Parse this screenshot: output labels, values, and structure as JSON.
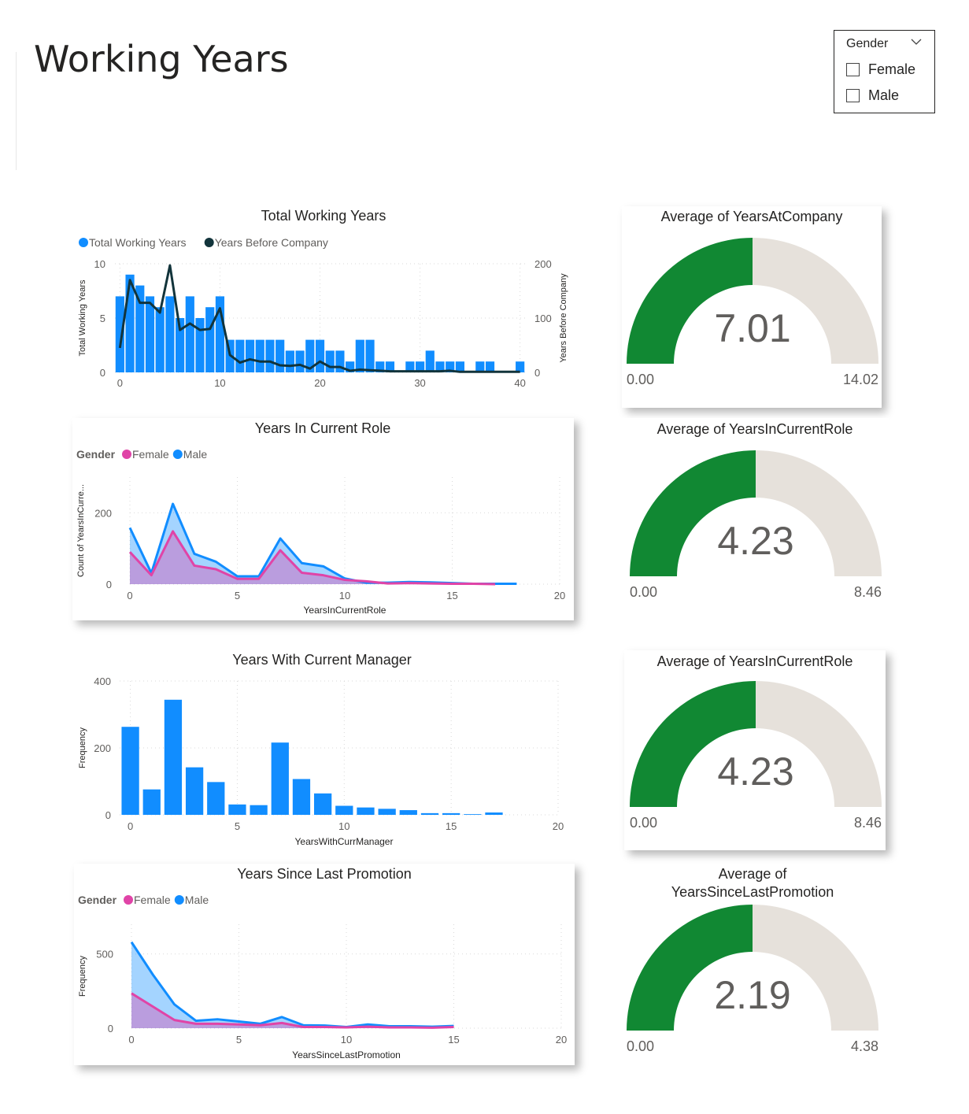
{
  "page": {
    "title": "Working Years"
  },
  "slicer": {
    "header": "Gender",
    "options": [
      "Female",
      "Male"
    ]
  },
  "charts": {
    "total_working_years": {
      "type": "bar",
      "title": "Total Working Years",
      "legend": [
        "Total Working Years",
        "Years Before Company"
      ],
      "ylabel": "Total Working Years",
      "y2label": "Years Before Company",
      "ylim": [
        0,
        10
      ],
      "y2lim": [
        0,
        200
      ],
      "xlim": [
        -0.5,
        40.5
      ],
      "yticks": [
        "0",
        "5",
        "10"
      ],
      "y2ticks": [
        "0",
        "100",
        "200"
      ],
      "xticks": [
        "0",
        "10",
        "20",
        "30",
        "40"
      ],
      "x": [
        0,
        1,
        2,
        3,
        4,
        5,
        6,
        7,
        8,
        9,
        10,
        11,
        12,
        13,
        14,
        15,
        16,
        17,
        18,
        19,
        20,
        21,
        22,
        23,
        24,
        25,
        26,
        27,
        28,
        29,
        30,
        31,
        32,
        33,
        34,
        35,
        36,
        37,
        38,
        39,
        40
      ],
      "bars": [
        7,
        9,
        8,
        7,
        6,
        7,
        5,
        7,
        5,
        6,
        7,
        3,
        3,
        3,
        3,
        3,
        3,
        2,
        2,
        3,
        3,
        2,
        2,
        1,
        3,
        3,
        1,
        1,
        0,
        1,
        1,
        2,
        1,
        1,
        1,
        0,
        1,
        1,
        0,
        0,
        1
      ],
      "line": [
        45,
        170,
        128,
        128,
        110,
        197,
        78,
        90,
        78,
        80,
        118,
        32,
        18,
        24,
        20,
        20,
        13,
        12,
        14,
        7,
        20,
        10,
        10,
        3,
        5,
        4,
        3,
        2,
        2,
        2,
        2,
        2,
        2,
        3,
        1,
        1,
        1,
        1,
        1,
        1,
        1
      ],
      "series_colors": [
        "#118DFF",
        "#12343B"
      ]
    },
    "years_in_current_role": {
      "type": "area",
      "title": "Years In Current Role",
      "legend_title": "Gender",
      "legend": [
        "Female",
        "Male"
      ],
      "xlabel": "YearsInCurrentRole",
      "ylabel": "Count of YearsInCurre...",
      "ylim": [
        0,
        300
      ],
      "xlim": [
        0,
        20
      ],
      "yticks": [
        "0",
        "200"
      ],
      "xticks": [
        "0",
        "5",
        "10",
        "15",
        "20"
      ],
      "x": [
        0,
        1,
        2,
        3,
        4,
        5,
        6,
        7,
        8,
        9,
        10,
        11,
        12,
        13,
        14,
        15,
        16,
        17,
        18
      ],
      "series": [
        {
          "name": "Female",
          "values": [
            90,
            25,
            148,
            52,
            42,
            15,
            15,
            95,
            32,
            25,
            12,
            8,
            2,
            3,
            2,
            1,
            1,
            0,
            null
          ]
        },
        {
          "name": "Male",
          "values": [
            158,
            31,
            225,
            85,
            63,
            22,
            22,
            128,
            59,
            50,
            16,
            4,
            4,
            6,
            5,
            3,
            1,
            1,
            1
          ]
        }
      ],
      "series_colors": [
        "#E044A7",
        "#118DFF"
      ]
    },
    "years_with_current_manager": {
      "type": "bar",
      "title": "Years With Current Manager",
      "xlabel": "YearsWithCurrManager",
      "ylabel": "Frequency",
      "ylim": [
        0,
        400
      ],
      "xlim": [
        -0.5,
        20
      ],
      "yticks": [
        "0",
        "200",
        "400"
      ],
      "xticks": [
        "0",
        "5",
        "10",
        "15",
        "20"
      ],
      "x": [
        0,
        1,
        2,
        3,
        4,
        5,
        6,
        7,
        8,
        9,
        10,
        11,
        12,
        13,
        14,
        15,
        16,
        17
      ],
      "values": [
        263,
        76,
        344,
        142,
        98,
        31,
        29,
        216,
        107,
        64,
        27,
        22,
        18,
        14,
        5,
        5,
        2,
        7
      ],
      "series_colors": [
        "#118DFF"
      ]
    },
    "years_since_last_promotion": {
      "type": "area",
      "title": "Years Since Last Promotion",
      "legend_title": "Gender",
      "legend": [
        "Female",
        "Male"
      ],
      "xlabel": "YearsSinceLastPromotion",
      "ylabel": "Frequency",
      "ylim": [
        0,
        700
      ],
      "xlim": [
        0,
        20
      ],
      "yticks": [
        "0",
        "500"
      ],
      "xticks": [
        "0",
        "5",
        "10",
        "15",
        "20"
      ],
      "x": [
        0,
        1,
        2,
        3,
        4,
        5,
        6,
        7,
        8,
        9,
        10,
        11,
        12,
        13,
        14,
        15
      ],
      "series": [
        {
          "name": "Female",
          "values": [
            235,
            145,
            55,
            30,
            30,
            25,
            20,
            35,
            8,
            8,
            5,
            10,
            5,
            5,
            3,
            8
          ]
        },
        {
          "name": "Male",
          "values": [
            580,
            360,
            160,
            50,
            60,
            45,
            30,
            75,
            20,
            18,
            8,
            25,
            13,
            13,
            10,
            15
          ]
        }
      ],
      "series_colors": [
        "#E044A7",
        "#118DFF"
      ]
    }
  },
  "gauges": [
    {
      "title": "Average of YearsAtCompany",
      "value": 7.01,
      "value_label": "7.01",
      "min_label": "0.00",
      "max_label": "14.02",
      "max": 14.02
    },
    {
      "title": "Average of YearsInCurrentRole",
      "value": 4.23,
      "value_label": "4.23",
      "min_label": "0.00",
      "max_label": "8.46",
      "max": 8.46
    },
    {
      "title": "Average of YearsInCurrentRole",
      "value": 4.23,
      "value_label": "4.23",
      "min_label": "0.00",
      "max_label": "8.46",
      "max": 8.46
    },
    {
      "title_lines": [
        "Average of",
        "YearsSinceLastPromotion"
      ],
      "value": 2.19,
      "value_label": "2.19",
      "min_label": "0.00",
      "max_label": "4.38",
      "max": 4.38
    }
  ],
  "colors": {
    "gauge_fill": "#118833",
    "gauge_track": "#E6E1DB",
    "grid": "#d9d9d9",
    "axis_text": "#605E5C"
  }
}
